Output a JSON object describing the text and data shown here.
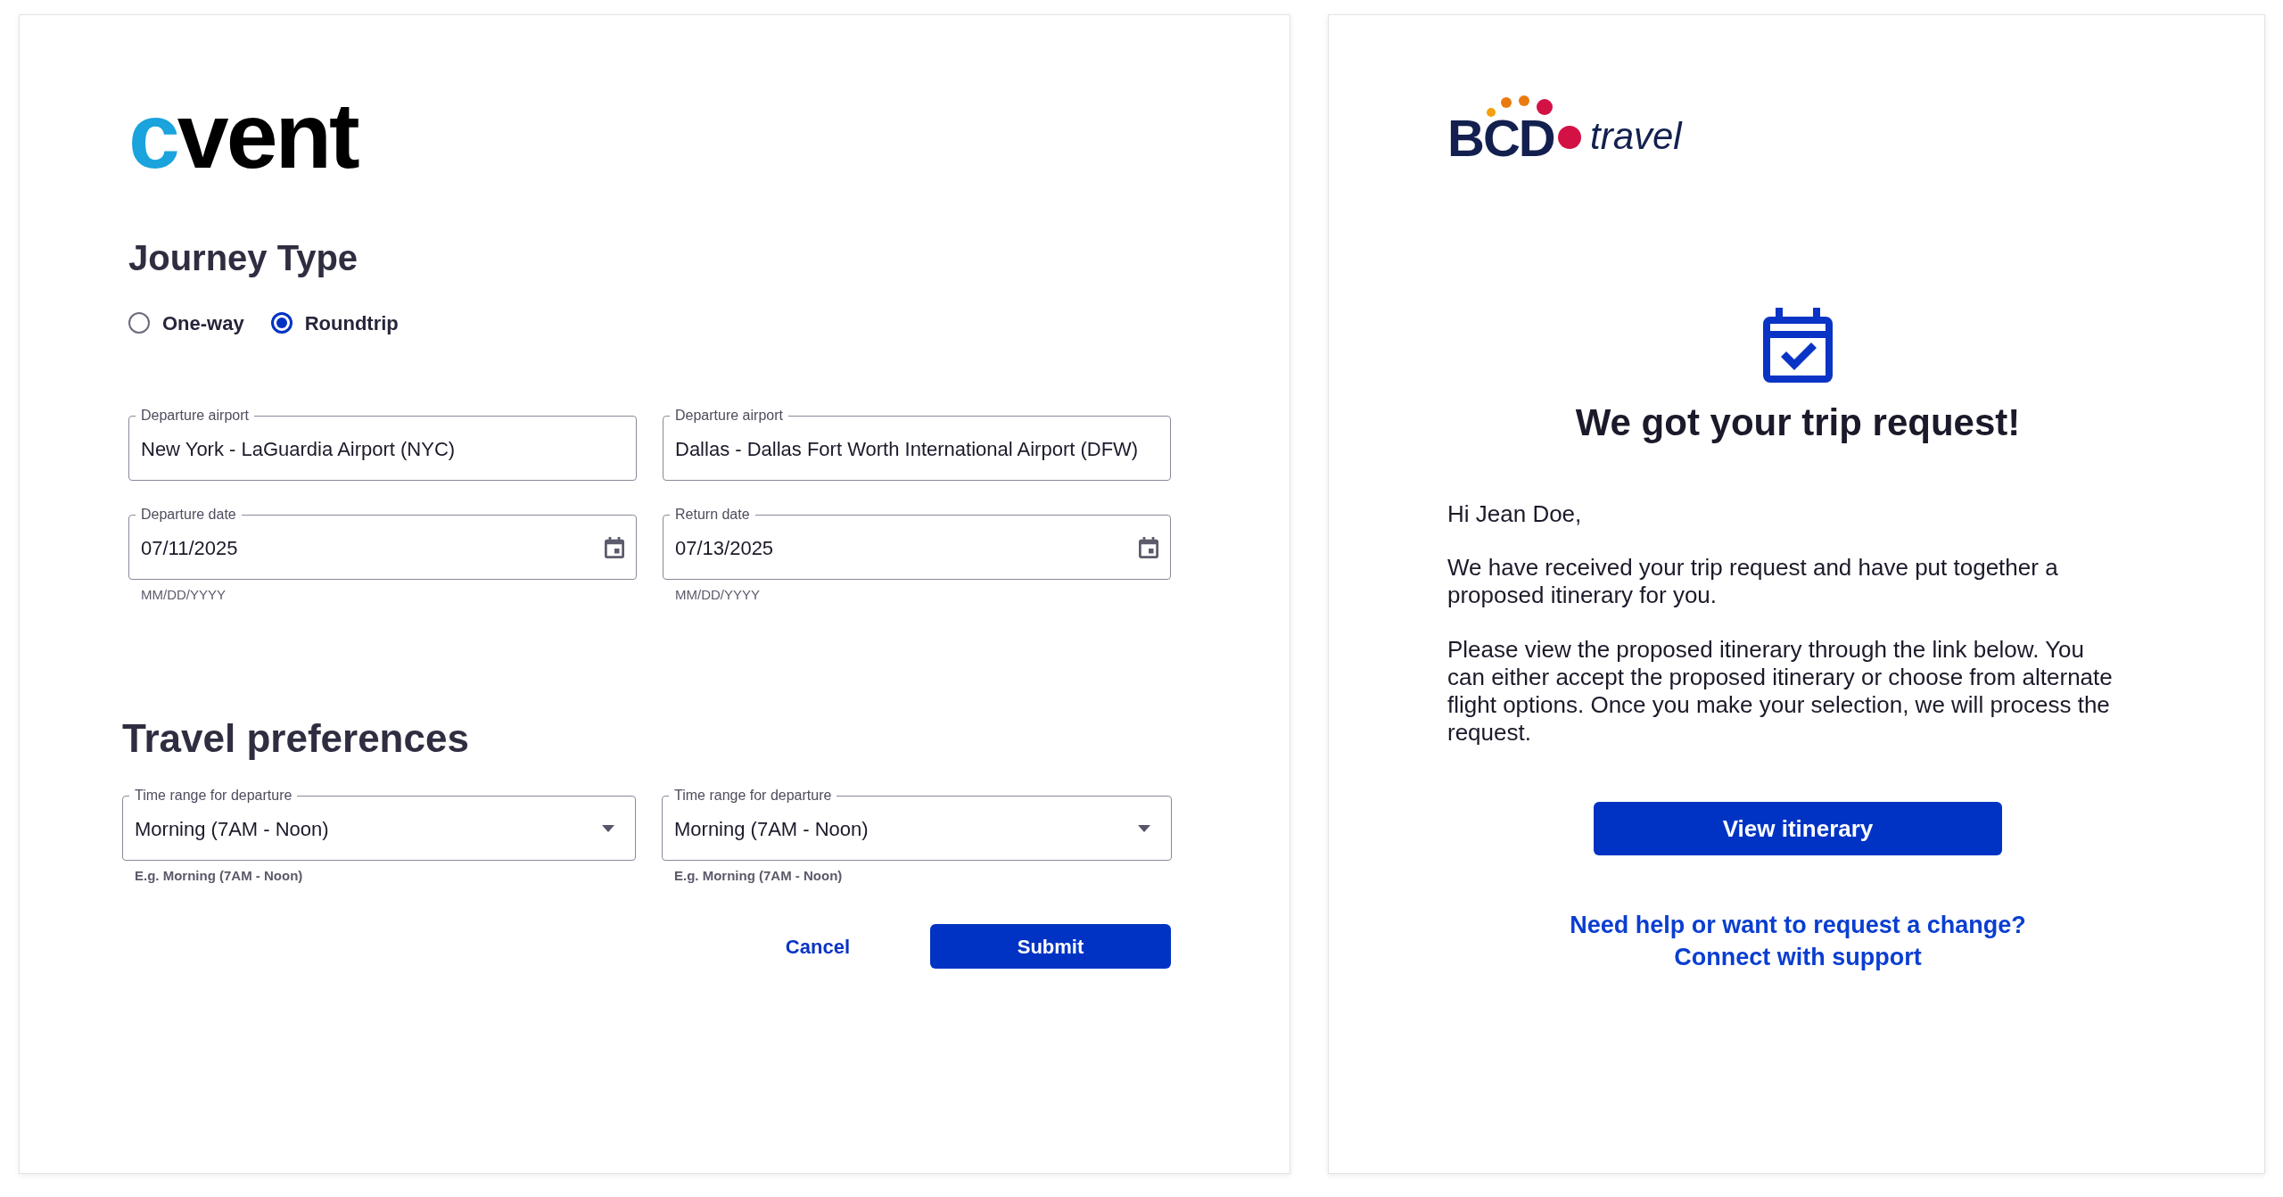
{
  "left_panel": {
    "logo": "cvent",
    "journey_type": {
      "title": "Journey Type",
      "options": [
        {
          "label": "One-way",
          "selected": false
        },
        {
          "label": "Roundtrip",
          "selected": true
        }
      ]
    },
    "trip_fields": [
      {
        "kind": "text",
        "label": "Departure airport",
        "value": "New York - LaGuardia Airport (NYC)"
      },
      {
        "kind": "text",
        "label": "Departure airport",
        "value": "Dallas - Dallas Fort Worth International Airport (DFW)"
      },
      {
        "kind": "date",
        "label": "Departure date",
        "value": "07/11/2025",
        "helper": "MM/DD/YYYY"
      },
      {
        "kind": "date",
        "label": "Return date",
        "value": "07/13/2025",
        "helper": "MM/DD/YYYY"
      }
    ],
    "travel_preferences": {
      "title": "Travel preferences",
      "fields": [
        {
          "kind": "select",
          "label": "Time range for departure",
          "value": "Morning (7AM - Noon)",
          "helper": "E.g. Morning (7AM - Noon)"
        },
        {
          "kind": "select",
          "label": "Time range for departure",
          "value": "Morning (7AM - Noon)",
          "helper": "E.g. Morning (7AM - Noon)"
        }
      ]
    },
    "buttons": [
      {
        "kind": "link",
        "label": "Cancel"
      },
      {
        "kind": "primary",
        "label": "Submit"
      }
    ]
  },
  "right_panel": {
    "logo": {
      "brand": "BCD",
      "suffix": "travel"
    },
    "heading": "We got your trip request!",
    "greeting": "Hi Jean Doe,",
    "paragraphs": [
      "We have received your trip request and have put together a proposed itinerary for you.",
      "Please view the proposed itinerary through the link below. You can either accept the proposed itinerary or choose from alternate flight options. Once you make your selection, we will process the request."
    ],
    "button": "View itinerary",
    "support_links": [
      "Need help or want to request a change?",
      "Connect with support"
    ]
  }
}
